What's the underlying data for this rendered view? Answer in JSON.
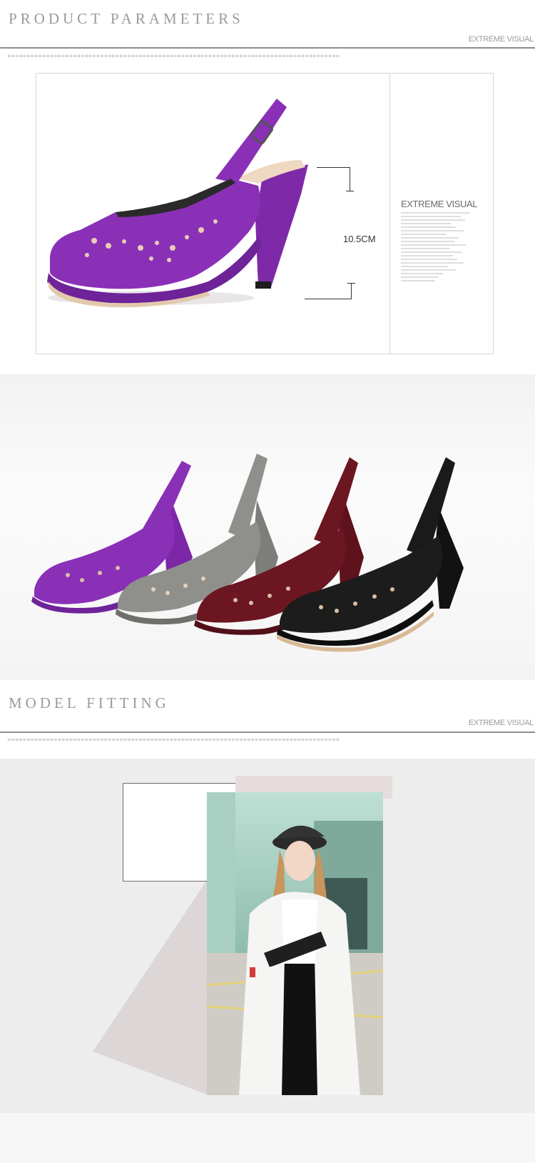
{
  "product_parameters": {
    "title": "PRODUCT PARAMETERS",
    "tag": "EXTREME VISUAL",
    "height_label": "10.5CM",
    "panel_title": "EXTREME VISUAL"
  },
  "colors_section": {
    "variants": [
      {
        "name": "purple",
        "color": "#8a2fb6"
      },
      {
        "name": "grey",
        "color": "#8f8f8b"
      },
      {
        "name": "burgundy",
        "color": "#6c1622"
      },
      {
        "name": "black",
        "color": "#1a1a1a"
      }
    ]
  },
  "model_fitting": {
    "title": "MODEL FITTING",
    "tag": "EXTREME VISUAL"
  },
  "chevron_text": "»»»»»»»»»»»»»»»»»»»»»»»»»»»»»»»»»»»»»»»»»»»»»»»»»»»»»»»»»»»»»»»»»»»»»»»»»»»»»»»»»»»»»»"
}
